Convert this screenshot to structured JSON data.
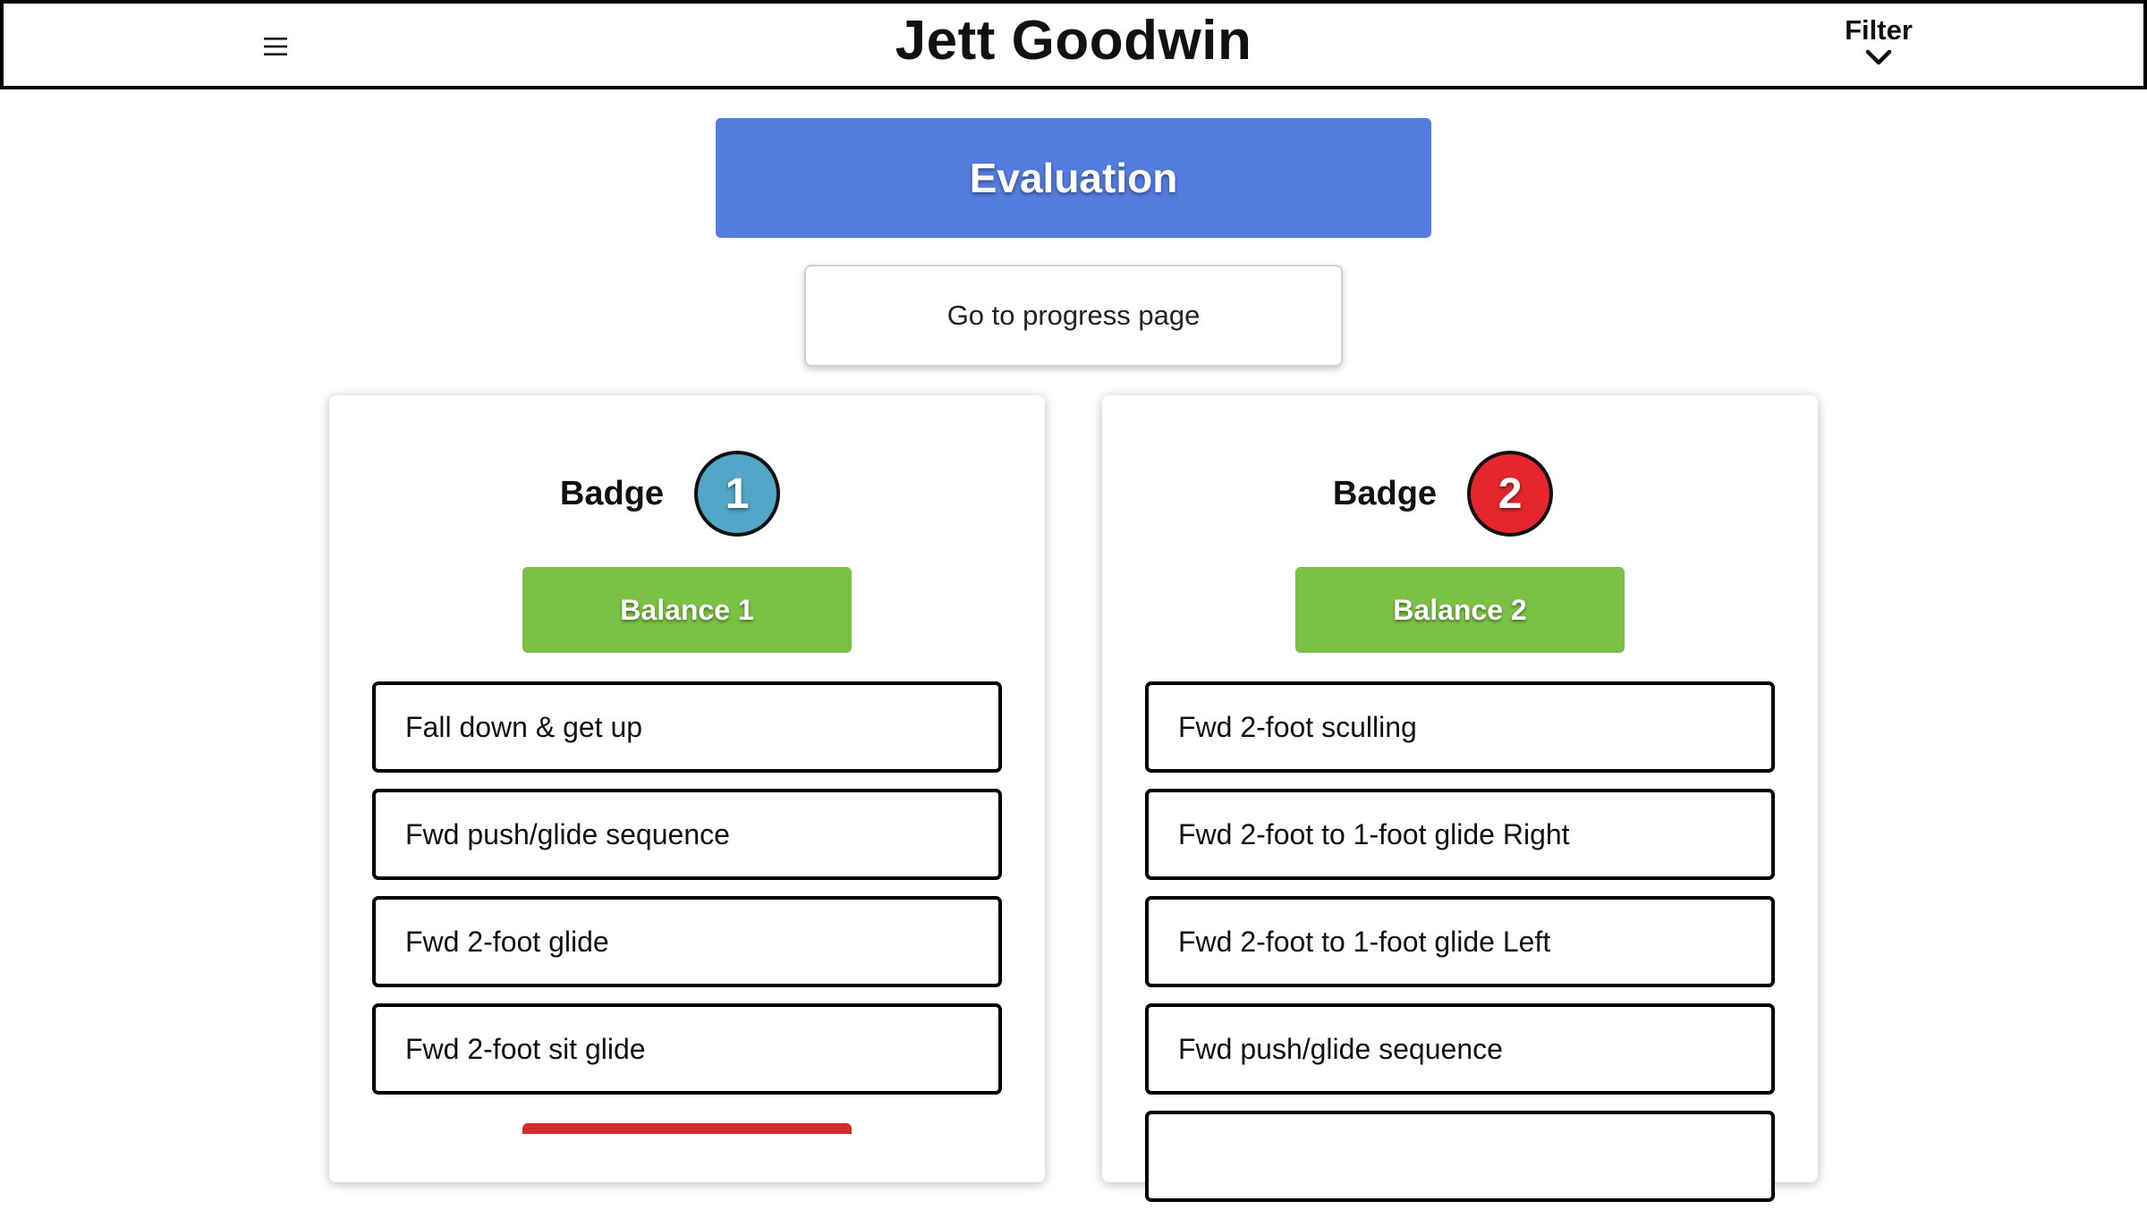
{
  "header": {
    "title": "Jett Goodwin",
    "menu_icon": "hamburger-icon",
    "filter_label": "Filter",
    "filter_icon": "chevron-down-icon"
  },
  "evaluation": {
    "label": "Evaluation",
    "color": "#547ddf"
  },
  "progress_button": {
    "label": "Go to progress page"
  },
  "cards": [
    {
      "badge_label": "Badge",
      "badge_number": "1",
      "badge_color": "#52a6c8",
      "level_label": "Balance 1",
      "level_color": "#7bc143",
      "skills": [
        "Fall down & get up",
        "Fwd push/glide sequence",
        "Fwd 2-foot glide",
        "Fwd 2-foot sit glide",
        ""
      ]
    },
    {
      "badge_label": "Badge",
      "badge_number": "2",
      "badge_color": "#e5262d",
      "level_label": "Balance 2",
      "level_color": "#7bc143",
      "skills": [
        "Fwd 2-foot sculling",
        "Fwd 2-foot to 1-foot glide Right",
        "Fwd 2-foot to 1-foot glide Left",
        "Fwd push/glide sequence",
        ""
      ]
    }
  ]
}
